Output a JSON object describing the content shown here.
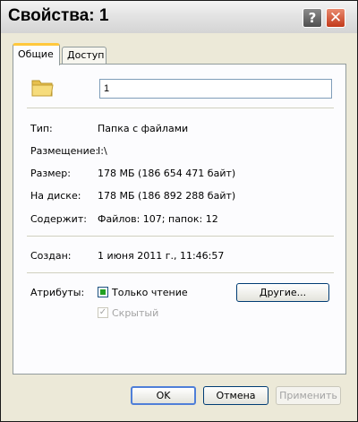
{
  "window": {
    "title": "Свойства: 1",
    "help_glyph": "?",
    "close_glyph": "✕"
  },
  "tabs": [
    {
      "label": "Общие",
      "active": true
    },
    {
      "label": "Доступ",
      "active": false
    }
  ],
  "general": {
    "icon": "folder-icon",
    "name_value": "1",
    "rows": {
      "type": {
        "label": "Тип:",
        "value": "Папка с файлами"
      },
      "location": {
        "label": "Размещение:",
        "value": "I:\\"
      },
      "size": {
        "label": "Размер:",
        "value": "178 МБ (186 654 471 байт)"
      },
      "size_on_disk": {
        "label": "На диске:",
        "value": "178 МБ (186 892 288 байт)"
      },
      "contains": {
        "label": "Содержит:",
        "value": "Файлов: 107; папок: 12"
      },
      "created": {
        "label": "Создан:",
        "value": "1 июня 2011 г., 11:46:57"
      }
    },
    "attributes": {
      "label": "Атрибуты:",
      "readonly_label": "Только чтение",
      "hidden_label": "Скрытый",
      "other_button": "Другие..."
    }
  },
  "buttons": {
    "ok": "OK",
    "cancel": "Отмена",
    "apply": "Применить"
  },
  "colors": {
    "folder": "#f1d36b",
    "tab_highlight": "#ffc83c",
    "readonly_check": "#21a121"
  }
}
